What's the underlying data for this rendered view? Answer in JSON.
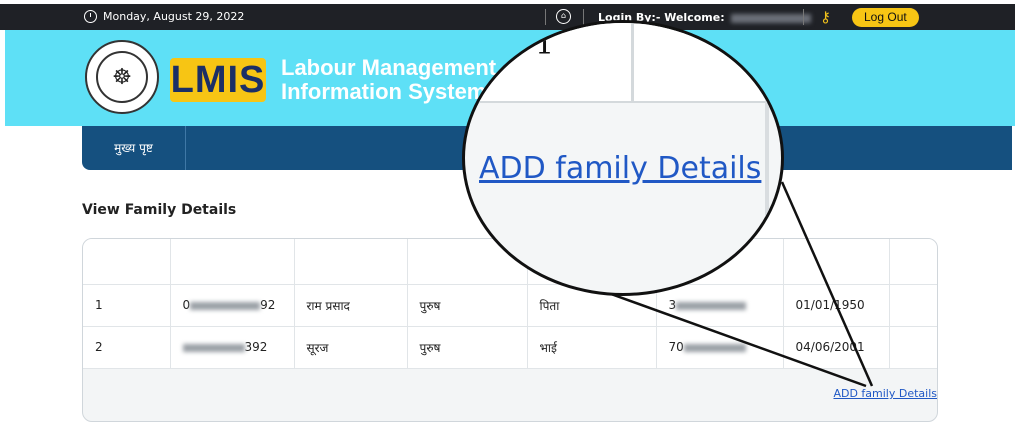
{
  "topbar": {
    "date": "Monday, August 29, 2022",
    "login_text": "Login By:- Welcome:",
    "logout_label": "Log Out"
  },
  "header": {
    "logo_text": "LMIS",
    "brand_line1": "Labour Management",
    "brand_line2": "Information System"
  },
  "nav": {
    "home_label": "मुख्य पृष्ट"
  },
  "page": {
    "title": "View Family Details"
  },
  "table": {
    "rows": [
      {
        "sno": "1",
        "id_prefix": "0",
        "id_suffix": "92",
        "name": "राम प्रसाद",
        "gender": "पुरुष",
        "relation": "पिता",
        "aadhaar_prefix": "3",
        "dob": "01/01/1950"
      },
      {
        "sno": "2",
        "id_prefix": "",
        "id_suffix": "392",
        "name": "सूरज",
        "gender": "पुरुष",
        "relation": "भाई",
        "aadhaar_prefix": "70",
        "dob": "04/06/2001"
      }
    ]
  },
  "actions": {
    "add_family_label": "ADD family Details"
  },
  "magnifier": {
    "zoom_link_label": "ADD family Details",
    "partial_char": "1"
  },
  "colors": {
    "topbar_bg": "#1f2126",
    "header_bg": "#5ee0f6",
    "nav_bg": "#15507f",
    "accent_yellow": "#f7c514",
    "link_blue": "#2058c5"
  }
}
